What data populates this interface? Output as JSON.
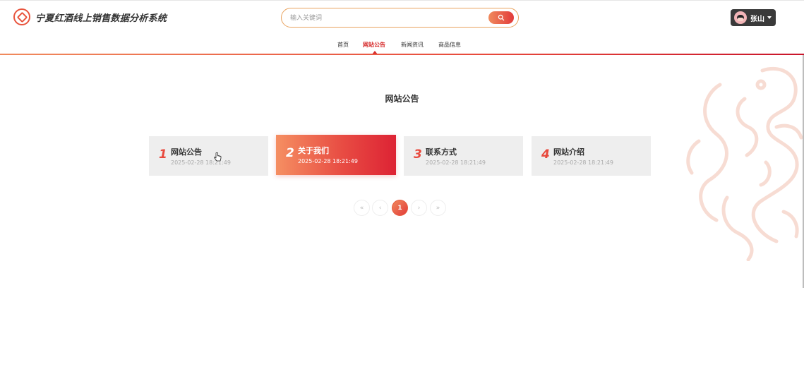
{
  "header": {
    "site_title": "宁夏红酒线上销售数据分析系统",
    "search": {
      "placeholder": "输入关键词",
      "value": ""
    },
    "user": {
      "name": "张山"
    }
  },
  "nav": {
    "items": [
      {
        "label": "首页",
        "active": false
      },
      {
        "label": "网站公告",
        "active": true
      },
      {
        "label": "新闻资讯",
        "active": false
      },
      {
        "label": "商品信息",
        "active": false
      }
    ]
  },
  "main": {
    "heading": "网站公告",
    "cards": [
      {
        "num": "1",
        "title": "网站公告",
        "date": "2025-02-28 18:21:49",
        "active": false
      },
      {
        "num": "2",
        "title": "关于我们",
        "date": "2025-02-28 18:21:49",
        "active": true
      },
      {
        "num": "3",
        "title": "联系方式",
        "date": "2025-02-28 18:21:49",
        "active": false
      },
      {
        "num": "4",
        "title": "网站介绍",
        "date": "2025-02-28 18:21:49",
        "active": false
      }
    ],
    "pagination": {
      "first": "«",
      "prev": "‹",
      "current": "1",
      "next": "›",
      "last": "»"
    }
  },
  "colors": {
    "accent": "#e8493d",
    "accent_dark": "#d62a2a",
    "gradient_start": "#f58f62",
    "gradient_end": "#dd2334",
    "card_bg": "#eeeeee"
  },
  "icons": {
    "logo": "wine-logo-icon",
    "search": "search-icon",
    "avatar": "user-avatar-icon",
    "dropdown": "chevron-down-icon",
    "decoration": "dragon-watermark-icon"
  }
}
